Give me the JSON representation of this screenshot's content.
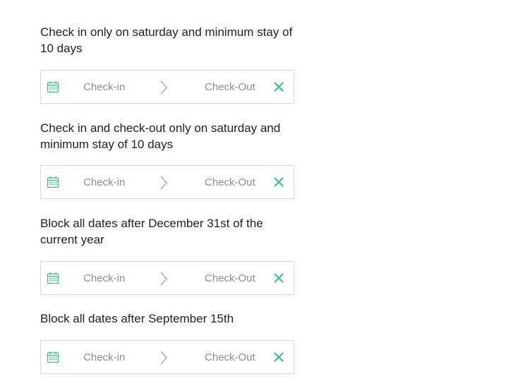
{
  "accent_color": "#3bbf94",
  "pickers": [
    {
      "heading": "Check in only on saturday and minimum stay of 10 days",
      "check_in": "Check-in",
      "check_out": "Check-Out"
    },
    {
      "heading": "Check in and check-out only on saturday and minimum stay of 10 days",
      "check_in": "Check-in",
      "check_out": "Check-Out"
    },
    {
      "heading": "Block all dates after December 31st of the current year",
      "check_in": "Check-in",
      "check_out": "Check-Out"
    },
    {
      "heading": "Block all dates after September 15th",
      "check_in": "Check-in",
      "check_out": "Check-Out"
    }
  ]
}
